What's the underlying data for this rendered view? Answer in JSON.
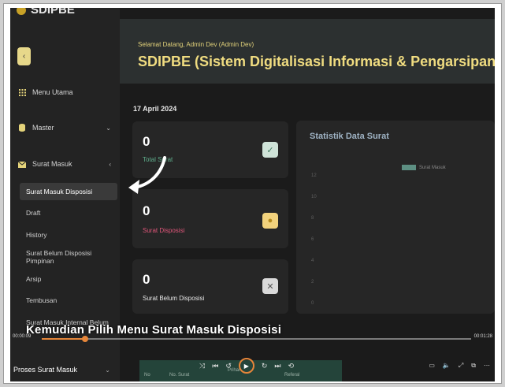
{
  "app": {
    "brand": "SDIPBE",
    "collapse_icon": "chevron-left-icon"
  },
  "sidebar": {
    "items": [
      {
        "label": "Menu Utama",
        "icon": "grid-icon"
      },
      {
        "label": "Master",
        "icon": "database-icon"
      },
      {
        "label": "Surat Masuk",
        "icon": "mail-icon"
      }
    ],
    "sub_items": [
      {
        "label": "Surat Masuk Disposisi",
        "active": true
      },
      {
        "label": "Draft"
      },
      {
        "label": "History"
      },
      {
        "label": "Surat Belum Disposisi Pimpinan"
      },
      {
        "label": "Arsip"
      },
      {
        "label": "Tembusan"
      },
      {
        "label": "Surat Masuk Internal Belum"
      }
    ],
    "bottom_label": "Proses Surat Masuk"
  },
  "hero": {
    "welcome": "Selamat Datang, Admin Dev (Admin Dev)",
    "title": "SDIPBE (Sistem Digitalisasi Informasi & Pengarsipan Berbasis"
  },
  "date": "17 April 2024",
  "cards": [
    {
      "value": "0",
      "label": "Total Surat",
      "label_color": "#5fae8c",
      "badge_icon": "check-icon",
      "badge_bg": "#cfe3d8",
      "badge_color": "#3f7a5e"
    },
    {
      "value": "0",
      "label": "Surat Disposisi",
      "label_color": "#e0567a",
      "badge_icon": "coin-icon",
      "badge_bg": "#f2d27c",
      "badge_color": "#b48a1c"
    },
    {
      "value": "0",
      "label": "Surat Belum Disposisi",
      "label_color": "#e8e8e8",
      "badge_icon": "x-icon",
      "badge_bg": "#d9d9d9",
      "badge_color": "#555555"
    }
  ],
  "stats": {
    "title": "Statistik Data Surat",
    "legend": "Surat Masuk",
    "y_ticks": [
      "12",
      "10",
      "8",
      "6",
      "4",
      "2",
      "0"
    ]
  },
  "caption": "Kemudian Pilih Menu Surat Masuk Disposisi",
  "player": {
    "time_current": "00:00:09",
    "time_total": "00:01:28",
    "progress": 0.1
  },
  "table_headers": [
    "No",
    "No. Surat",
    "Prihal",
    "Referal"
  ],
  "colors": {
    "accent": "#e6863a",
    "brand_yellow": "#f0dc80"
  }
}
